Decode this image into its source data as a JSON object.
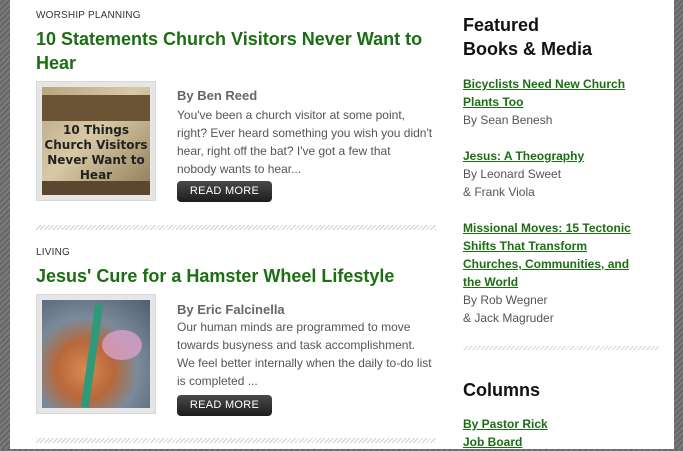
{
  "articles": [
    {
      "category": "WORSHIP PLANNING",
      "title": "10 Statements Church Visitors Never Want to Hear",
      "thumb_text": "10 Things Church Visitors Never Want to Hear",
      "author": "By Ben Reed",
      "excerpt": "You've been a church visitor at some point, right? Ever heard something you wish you didn't hear, right off the bat? I've got a few that nobody wants to hear...",
      "read_more": "READ MORE"
    },
    {
      "category": "LIVING",
      "title": "Jesus' Cure for a Hamster Wheel Lifestyle",
      "author": "By Eric Falcinella",
      "excerpt": "Our human minds are programmed to move towards busyness and task accomplishment. We feel better internally when the daily to-do list is completed ...",
      "read_more": "READ MORE"
    }
  ],
  "sidebar": {
    "featured_heading_line1": "Featured",
    "featured_heading_line2": "Books & Media",
    "books": [
      {
        "title": "Bicyclists Need New Church Plants Too",
        "authors": [
          "By Sean Benesh"
        ]
      },
      {
        "title": "Jesus: A Theography",
        "authors": [
          "By Leonard Sweet",
          "& Frank Viola"
        ]
      },
      {
        "title": "Missional Moves: 15 Tectonic Shifts That Transform Churches, Communities, and the World",
        "authors": [
          "By Rob Wegner",
          "& Jack Magruder"
        ]
      }
    ],
    "columns_heading": "Columns",
    "columns": [
      "By Pastor Rick",
      "Job Board"
    ]
  },
  "colors": {
    "link_green": "#1b6e12",
    "button_dark": "#2a2a2a"
  }
}
